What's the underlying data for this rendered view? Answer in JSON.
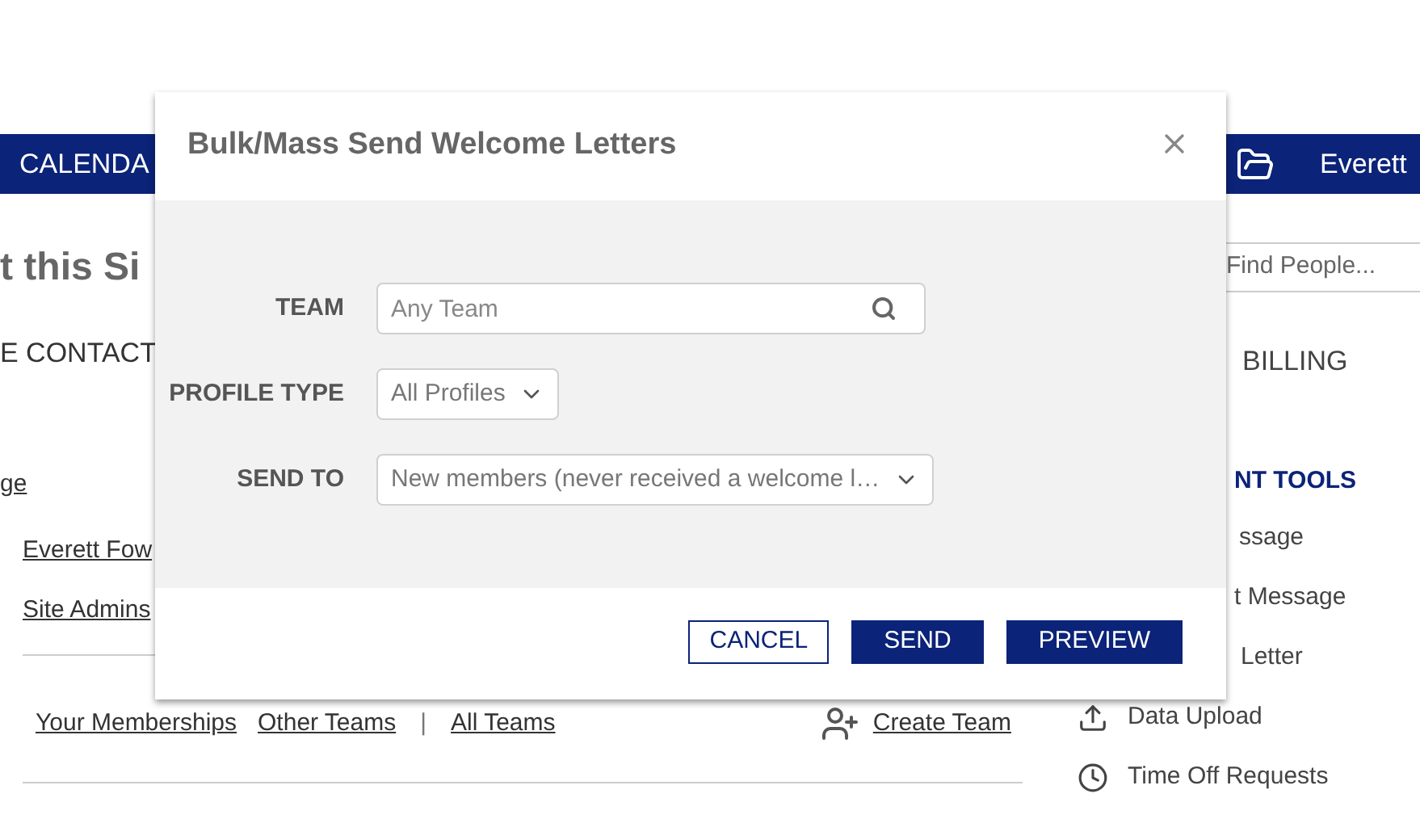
{
  "nav": {
    "left_item": "CALENDA",
    "user": "Everett"
  },
  "page": {
    "heading": "t this Si",
    "contact_tab": "E CONTACT",
    "link": "ge",
    "people": [
      "Everett Fow",
      "Site Admins"
    ],
    "team_links": [
      {
        "kind": "link",
        "label": "Your Memberships"
      },
      {
        "kind": "link",
        "label": "Other Teams"
      },
      {
        "kind": "separator",
        "label": "|"
      },
      {
        "kind": "link",
        "label": "All Teams"
      }
    ],
    "create_team": "Create Team"
  },
  "sidebar": {
    "search_placeholder": "Find People...",
    "billing": "BILLING",
    "tools_heading": "NT TOOLS",
    "tools": [
      {
        "label": "ssage"
      },
      {
        "label": "t Message"
      },
      {
        "label": "Letter"
      },
      {
        "label": "Data Upload"
      },
      {
        "label": "Time Off Requests"
      }
    ]
  },
  "dialog": {
    "title": "Bulk/Mass Send Welcome Letters",
    "fields": [
      {
        "label": "TEAM",
        "kind": "search",
        "placeholder": "Any Team"
      },
      {
        "label": "PROFILE TYPE",
        "kind": "select",
        "value": "All Profiles"
      },
      {
        "label": "SEND TO",
        "kind": "select",
        "value": "New members (never received a welcome l…"
      }
    ],
    "buttons": [
      {
        "label": "CANCEL",
        "kind": "secondary"
      },
      {
        "label": "SEND",
        "kind": "primary"
      },
      {
        "label": "PREVIEW",
        "kind": "primary"
      }
    ]
  }
}
